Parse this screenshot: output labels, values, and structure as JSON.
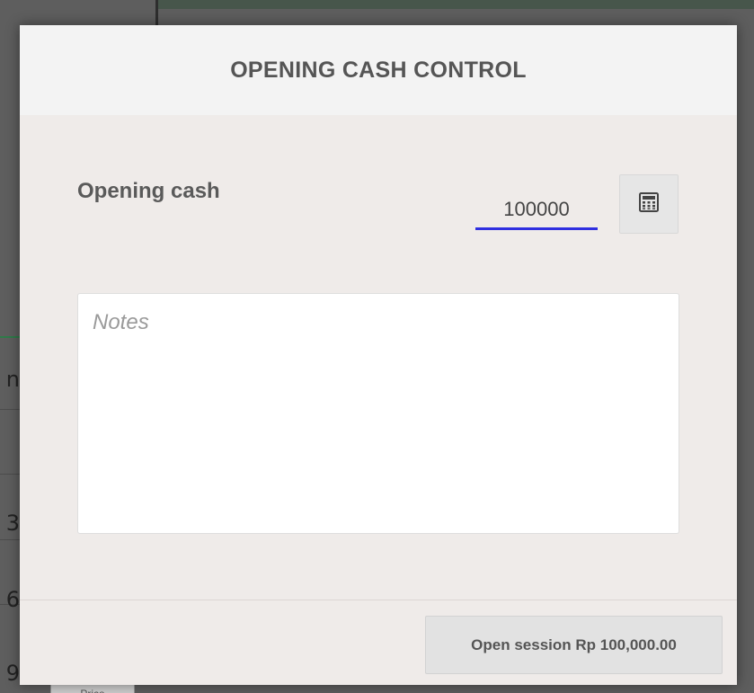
{
  "background": {
    "edge_glyphs": [
      "n",
      "3",
      "6",
      "9"
    ],
    "bottom_tab_label": "Price"
  },
  "dialog": {
    "title": "OPENING CASH CONTROL",
    "opening_cash_label": "Opening cash",
    "opening_cash_value": "100000",
    "calculator_icon": "calculator-icon",
    "notes_placeholder": "Notes",
    "notes_value": "",
    "open_session_label": "Open session Rp 100,000.00",
    "accent_color": "#2f2fe0"
  }
}
